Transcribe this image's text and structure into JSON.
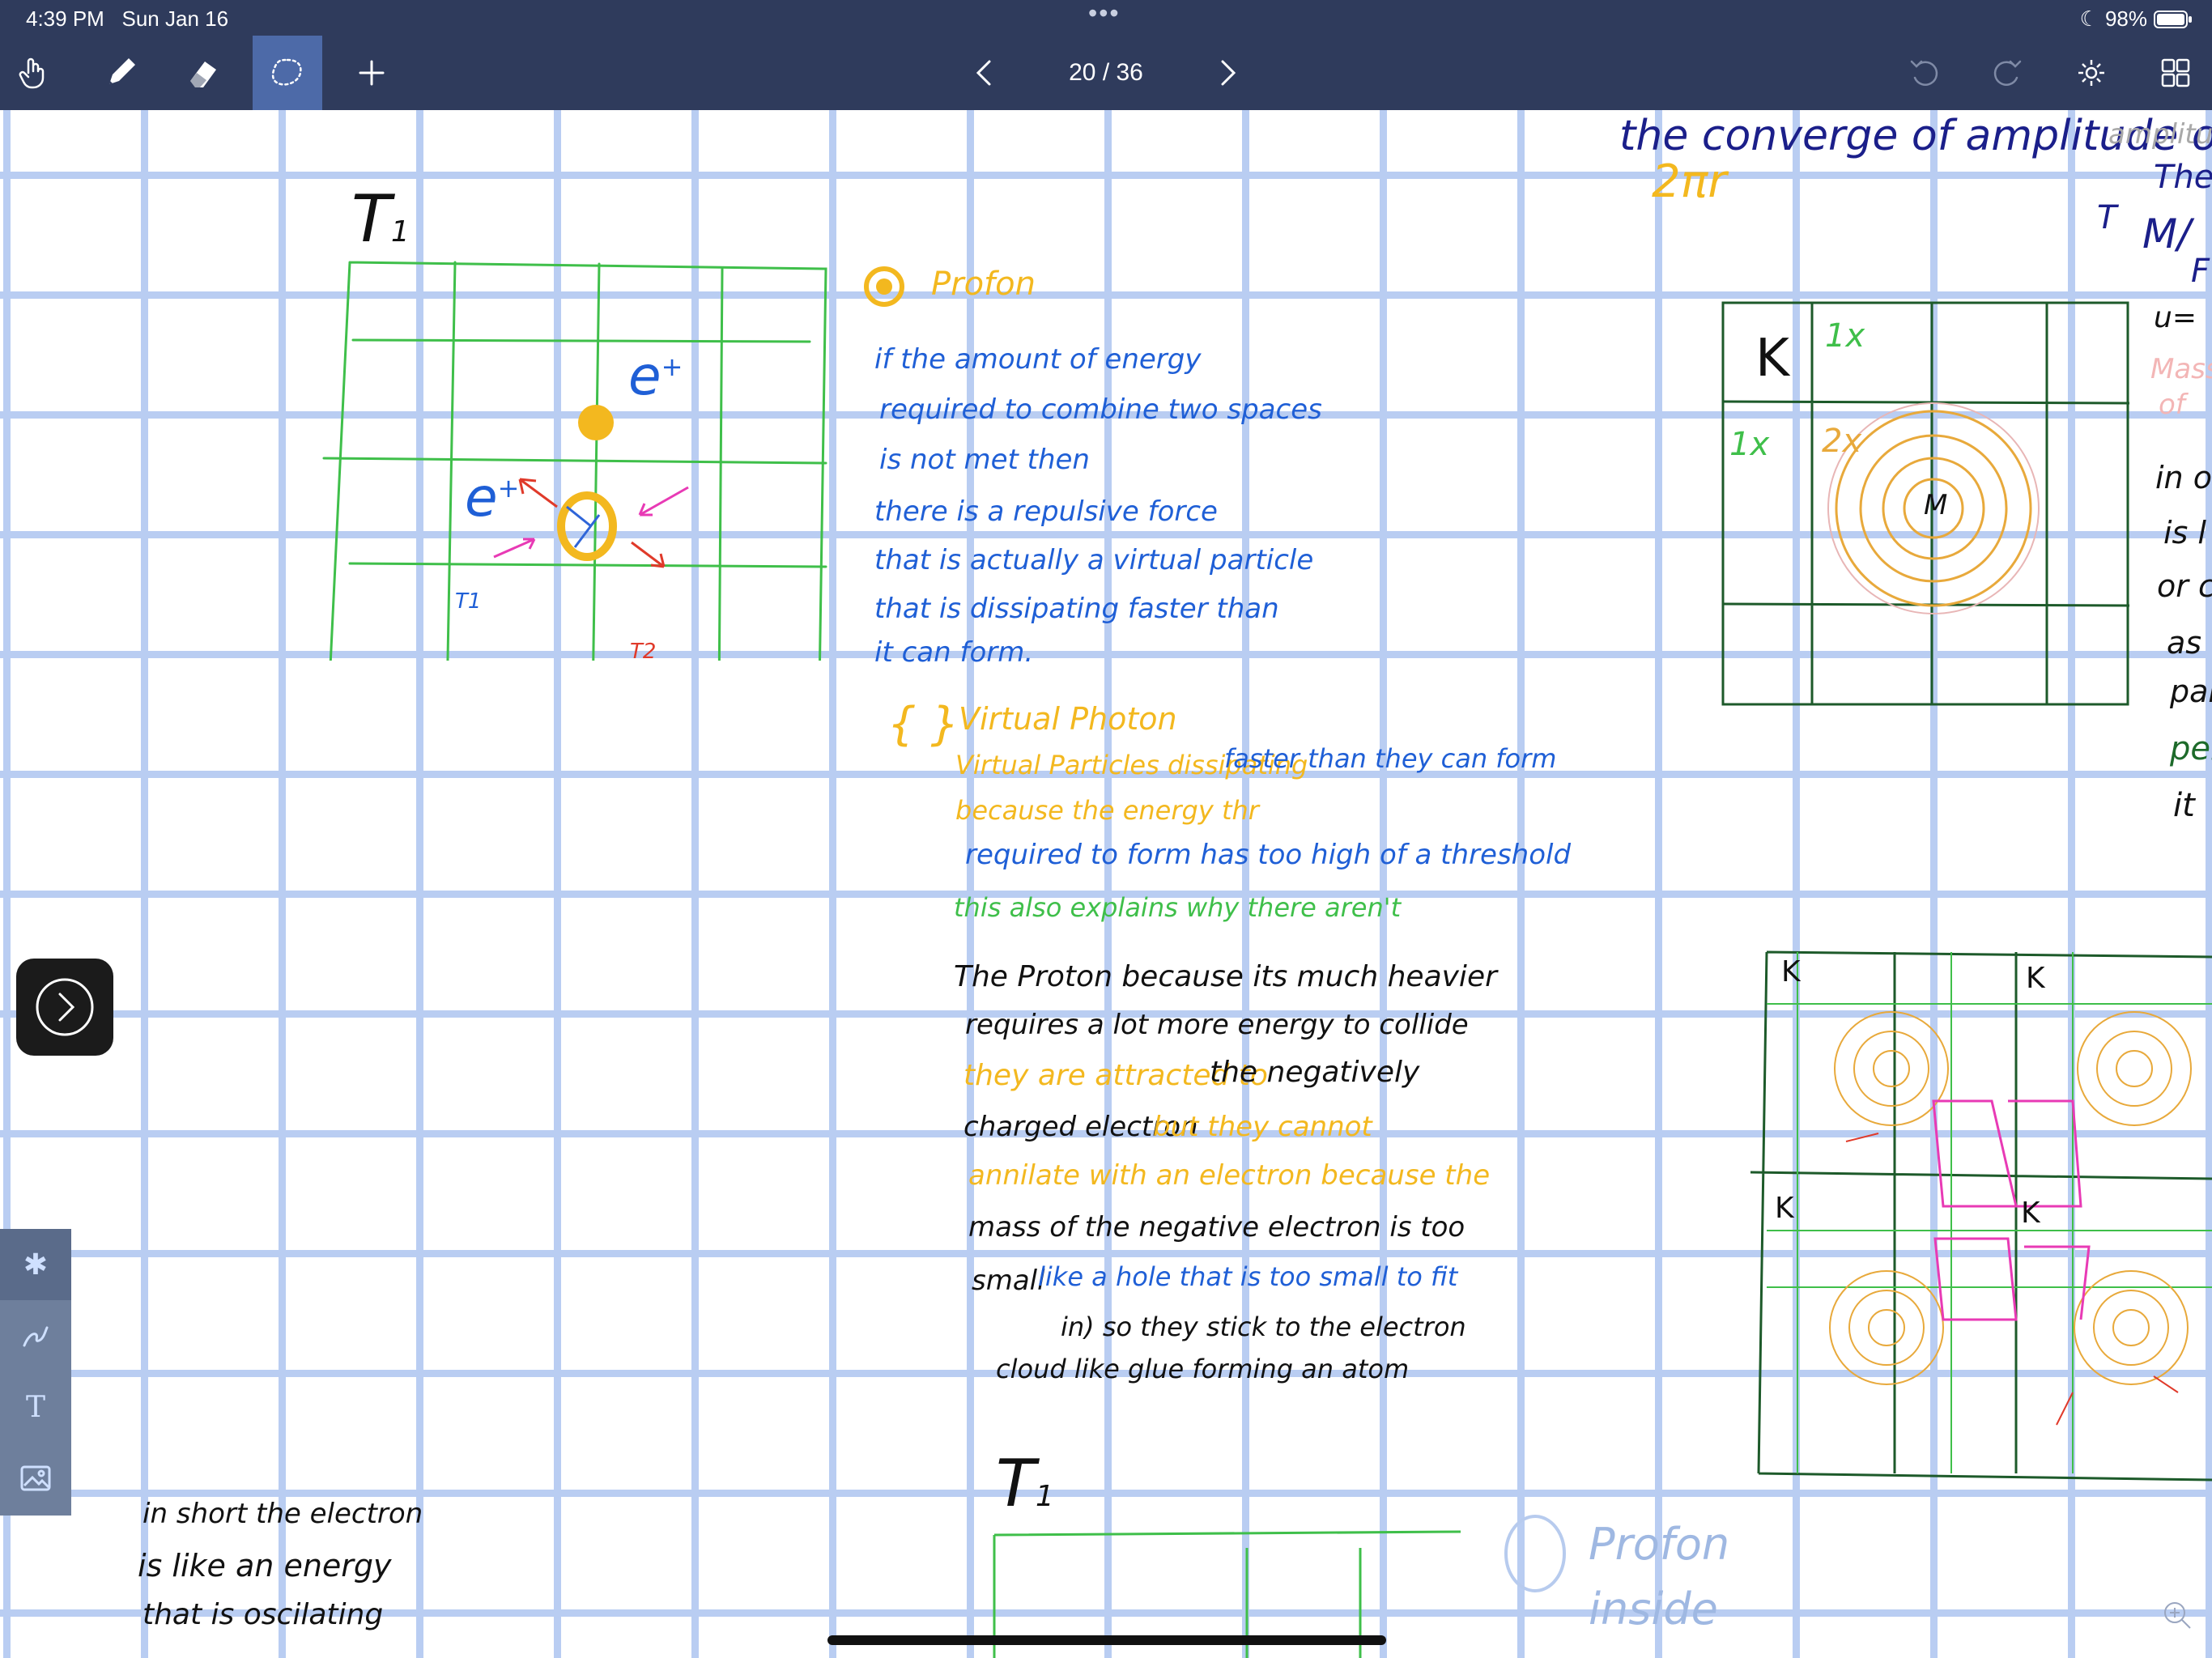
{
  "status": {
    "time": "4:39 PM",
    "date": "Sun Jan 16",
    "dots": "•••",
    "battery": "98%"
  },
  "toolbar": {
    "tools": [
      {
        "name": "hand-icon"
      },
      {
        "name": "pen-icon"
      },
      {
        "name": "eraser-icon"
      },
      {
        "name": "lasso-icon",
        "active": true
      },
      {
        "name": "plus-icon"
      }
    ],
    "page_indicator": "20 / 36",
    "right": [
      "undo-icon",
      "redo-icon",
      "gear-icon",
      "grid-view-icon"
    ]
  },
  "notes": {
    "t1_top": "T",
    "t1_sub": "1",
    "protom_label": "Profon",
    "para1": [
      "if the amount of energy",
      "required to combine two spaces",
      "is not met then",
      "there is a repulsive force",
      "that is actually a virtual particle",
      "that is dissipating faster than",
      "it can form."
    ],
    "virtual_title": "Virtual Photon",
    "para2_yellow": [
      "Virtual Particles dissipating",
      "because the energy thr"
    ],
    "para2_blue": [
      "faster than they can form",
      "required to form has too high of a threshold"
    ],
    "para2_green": "this also explains why there aren't",
    "para3_black": [
      "The Proton because its much heavier",
      "requires a lot more energy to collide",
      "charged electron",
      "mass of the negative electron is too",
      "small",
      "in) so they stick to the electron",
      "cloud like glue forming an atom"
    ],
    "para3_yellow": [
      "they are attracted to",
      "but they cannot",
      "annilate with an electron because the"
    ],
    "para3_black_tail": "the negatively",
    "para3_blue": "like a hole that is too small to fit",
    "diagram_labels": {
      "e_plus": "e",
      "plus": "+",
      "t1": "T1",
      "t2": "T2",
      "k": "K",
      "m": "M",
      "lx": "1x",
      "two_x": "2x"
    },
    "top_right": [
      "the converge of amplitude of space",
      "2πr"
    ],
    "right_edge": [
      "amplitude",
      "The m",
      "T",
      "M/",
      "F",
      "u=",
      "Mass",
      "of",
      "in o",
      "is l",
      "or c",
      "as",
      "par",
      "per",
      "it"
    ],
    "bottom_left": [
      "in short the electron",
      "is like an energy",
      "that is oscilating"
    ],
    "bottom_mid": "T",
    "bottom_right": [
      "Profon",
      "inside"
    ]
  },
  "sidepanel": [
    "asterisk-icon",
    "scribble-icon",
    "text-icon",
    "image-icon"
  ]
}
